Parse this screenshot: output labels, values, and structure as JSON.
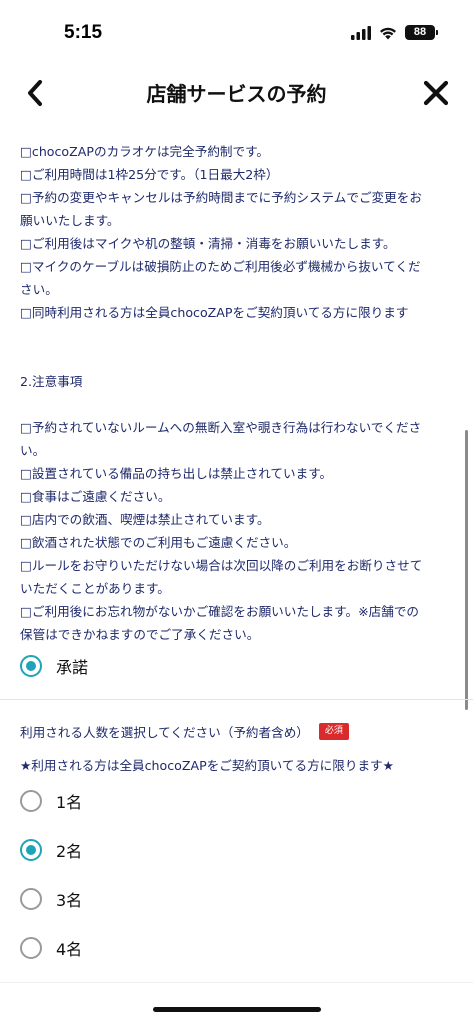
{
  "status_bar": {
    "time": "5:15",
    "battery": "88"
  },
  "header": {
    "title": "店舗サービスの予約"
  },
  "rules_lines": [
    "□chocoZAPのカラオケは完全予約制です。",
    "□ご利用時間は1枠25分です。（1日最大2枠）",
    "□予約の変更やキャンセルは予約時間までに予約システムでご変更をお",
    "願いいたします。",
    "□ご利用後はマイクや机の整頓・清掃・消毒をお願いいたします。",
    "□マイクのケーブルは破損防止のためご利用後必ず機械から抜いてくだ",
    "さい。",
    "□同時利用される方は全員chocoZAPをご契約頂いてる方に限ります"
  ],
  "notes_heading": "2.注意事項",
  "notes_lines": [
    "□予約されていないルームへの無断入室や覗き行為は行わないでくださ",
    "い。",
    "□設置されている備品の持ち出しは禁止されています。",
    "□食事はご遠慮ください。",
    "□店内での飲酒、喫煙は禁止されています。",
    "□飲酒された状態でのご利用もご遠慮ください。",
    "□ルールをお守りいただけない場合は次回以降のご利用をお断りさせて",
    "いただくことがあります。",
    "□ご利用後にお忘れ物がないかご確認をお願いいたします。※店舗での",
    "保管はできかねますのでご了承ください。"
  ],
  "consent": {
    "label": "承諾",
    "checked": true
  },
  "count_section": {
    "question": "利用される人数を選択してください（予約者含め）",
    "required_badge": "必須",
    "note": "★利用される方は全員chocoZAPをご契約頂いてる方に限ります★",
    "options": [
      {
        "label": "1名",
        "checked": false
      },
      {
        "label": "2名",
        "checked": true
      },
      {
        "label": "3名",
        "checked": false
      },
      {
        "label": "4名",
        "checked": false
      }
    ]
  },
  "icons": [
    "back-chevron-icon",
    "close-icon",
    "signal-icon",
    "wifi-icon",
    "battery-icon"
  ],
  "colors": {
    "text_navy": "#1f2a6b",
    "radio_accent": "#1fa3b8",
    "required_red": "#d92b2b"
  }
}
